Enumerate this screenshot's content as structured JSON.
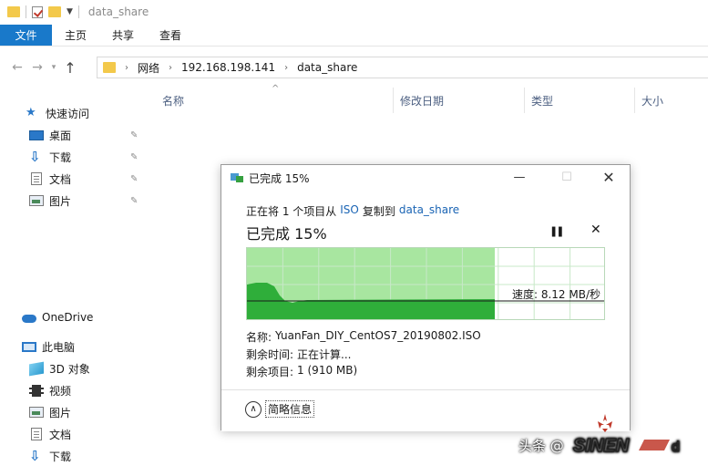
{
  "window": {
    "title": "data_share"
  },
  "ribbon": {
    "tabs": [
      {
        "label": "文件"
      },
      {
        "label": "主页"
      },
      {
        "label": "共享"
      },
      {
        "label": "查看"
      }
    ]
  },
  "address": {
    "crumbs": [
      "网络",
      "192.168.198.141",
      "data_share"
    ]
  },
  "columns": [
    {
      "label": "名称"
    },
    {
      "label": "修改日期"
    },
    {
      "label": "类型"
    },
    {
      "label": "大小"
    }
  ],
  "sidebar": {
    "quick_access": "快速访问",
    "pinned": [
      {
        "label": "桌面",
        "icon": "desktop-icon"
      },
      {
        "label": "下载",
        "icon": "download-icon"
      },
      {
        "label": "文档",
        "icon": "document-icon"
      },
      {
        "label": "图片",
        "icon": "pictures-icon"
      }
    ],
    "onedrive": "OneDrive",
    "this_pc": "此电脑",
    "pc_items": [
      {
        "label": "3D 对象",
        "icon": "3d-objects-icon"
      },
      {
        "label": "视频",
        "icon": "video-icon"
      },
      {
        "label": "图片",
        "icon": "pictures-icon"
      },
      {
        "label": "文档",
        "icon": "document-icon"
      },
      {
        "label": "下载",
        "icon": "download-icon"
      }
    ]
  },
  "dialog": {
    "title": "已完成 15%",
    "desc_prefix": "正在将 1 个项目从",
    "source": "ISO",
    "desc_middle": "复制到",
    "dest": "data_share",
    "heading": "已完成 15%",
    "progress": 15,
    "speed_label": "速度: 8.12 MB/秒",
    "name_label": "名称:",
    "name_value": "YuanFan_DIY_CentOS7_20190802.ISO",
    "time_label": "剩余时间:",
    "time_value": "正在计算...",
    "items_label": "剩余项目:",
    "items_value": "1 (910 MB)",
    "less_label": "简略信息"
  },
  "watermark": {
    "text": "头条 @"
  }
}
